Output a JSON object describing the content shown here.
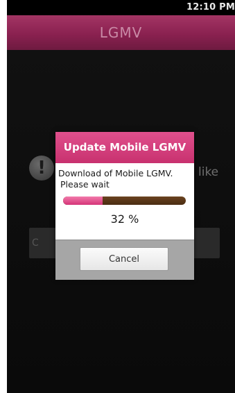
{
  "status_bar": {
    "time": "12:10 PM"
  },
  "app": {
    "title": "LGMV"
  },
  "background": {
    "partial_text": "like",
    "partial_button_text": "C"
  },
  "dialog": {
    "title": "Update Mobile LGMV",
    "message_line1": "Download of Mobile LGMV.",
    "message_line2": "Please wait",
    "progress": 32,
    "progress_label": "32 %",
    "cancel_label": "Cancel"
  },
  "colors": {
    "accent": "#c8316f",
    "title_bar": "#8a2150",
    "progress_track": "#4a2c12"
  }
}
